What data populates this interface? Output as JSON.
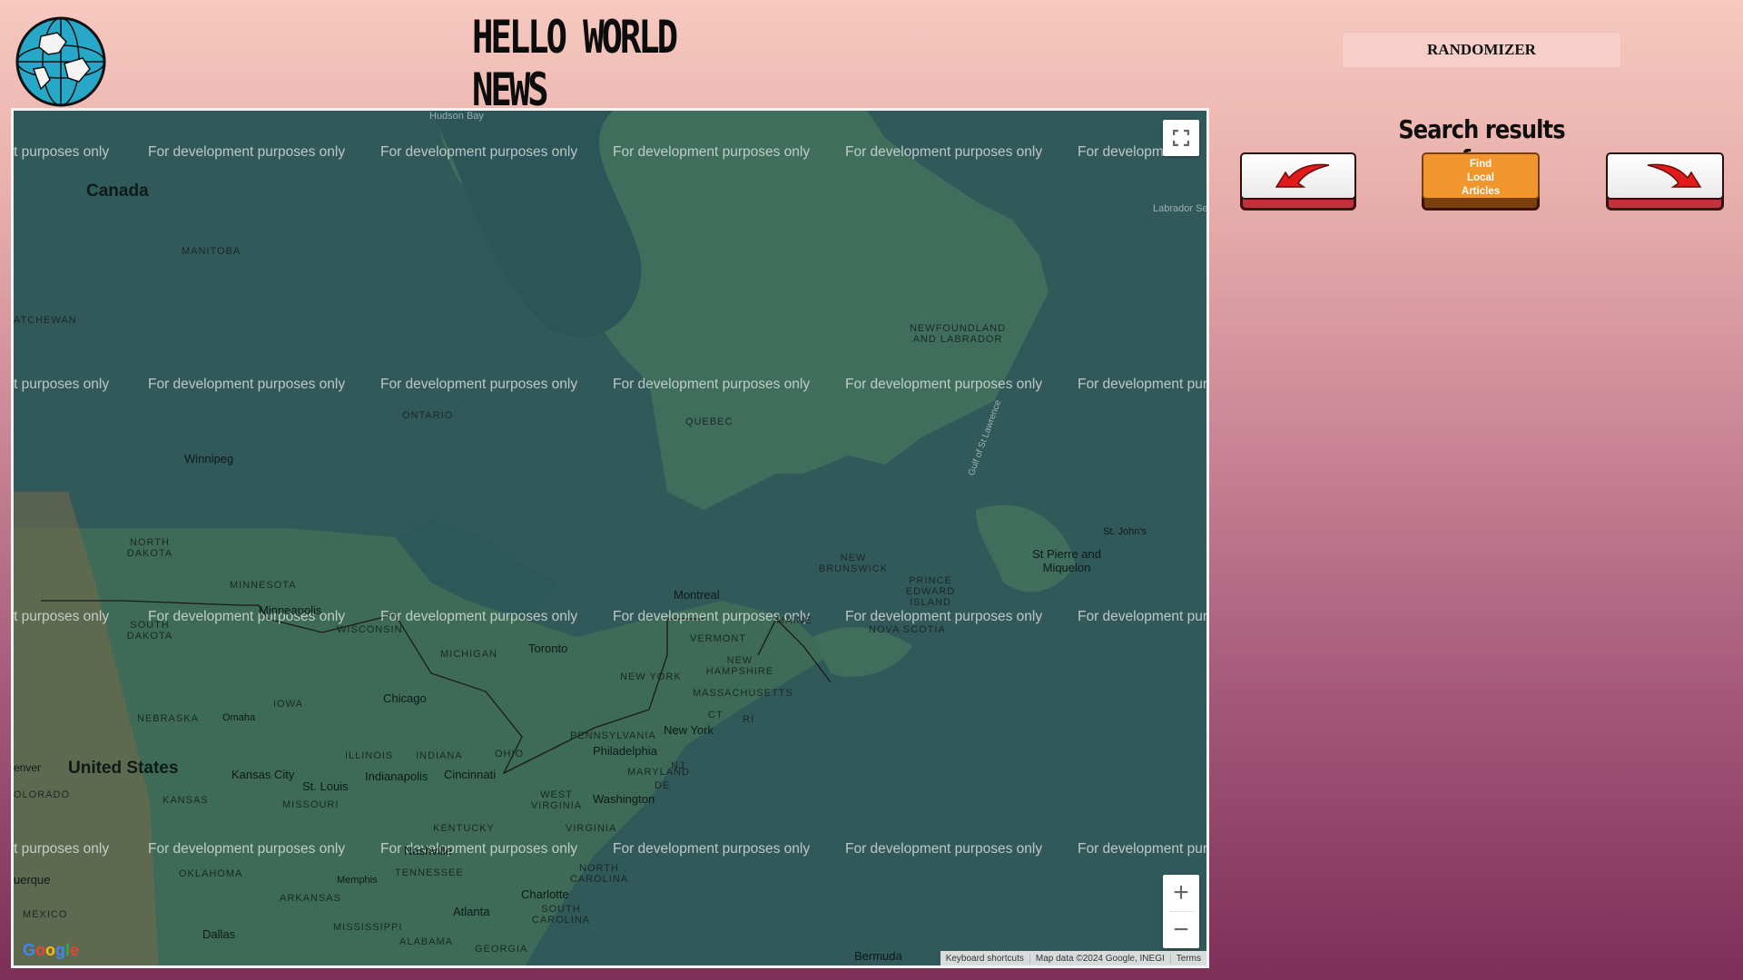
{
  "header": {
    "site_title": "HELLO WORLD NEWS",
    "logo_icon": "globe-icon",
    "randomizer_label": "RANDOMIZER"
  },
  "sidebar": {
    "search_title": "Search results for:",
    "prev_icon": "arrow-left-icon",
    "next_icon": "arrow-right-icon",
    "find_label_line1": "Find",
    "find_label_line2": "Local",
    "find_label_line3": "Articles"
  },
  "map": {
    "watermark": "For development purposes only",
    "watermark_cut_left": "t purposes only",
    "watermark_cut_right": "For developm",
    "watermark_cut_right2": "For development purp",
    "labels": {
      "hudson_bay": "Hudson Bay",
      "canada": "Canada",
      "labrador_sea": "Labrador Sea",
      "manitoba": "MANITOBA",
      "saskatchewan": "ATCHEWAN",
      "newfoundland": "NEWFOUNDLAND AND LABRADOR",
      "ontario": "ONTARIO",
      "quebec": "QUEBEC",
      "winnipeg": "Winnipeg",
      "gulf": "Gulf of St Lawrence",
      "st_johns": "St. John's",
      "st_pierre": "St Pierre and Miquelon",
      "north_dakota": "NORTH DAKOTA",
      "new_brunswick": "NEW BRUNSWICK",
      "pei": "PRINCE EDWARD ISLAND",
      "minnesota": "MINNESOTA",
      "montreal": "Montreal",
      "minneapolis": "Minneapolis",
      "south_dakota": "SOUTH DAKOTA",
      "wisconsin": "WISCONSIN",
      "nova_scotia": "NOVA SCOTIA",
      "vermont": "VERMONT",
      "maine": "MAINE",
      "michigan": "MICHIGAN",
      "toronto": "Toronto",
      "new_hampshire": "NEW HAMPSHIRE",
      "new_york_state": "NEW YORK",
      "massachusetts": "MASSACHUSETTS",
      "iowa": "IOWA",
      "chicago": "Chicago",
      "nebraska": "NEBRASKA",
      "omaha": "Omaha",
      "ct": "CT",
      "ri": "RI",
      "new_york": "New York",
      "pennsylvania": "PENNSYLVANIA",
      "philadelphia": "Philadelphia",
      "denver": "enver",
      "united_states": "United States",
      "kansas_city": "Kansas City",
      "indianapolis": "Indianapolis",
      "cincinnati": "Cincinnati",
      "illinois": "ILLINOIS",
      "indiana": "INDIANA",
      "ohio": "OHIO",
      "maryland": "MARYLAND",
      "nj": "NJ",
      "colorado": "OLORADO",
      "st_louis": "St. Louis",
      "washington": "Washington",
      "de": "DE",
      "kansas": "KANSAS",
      "missouri": "MISSOURI",
      "west_virginia": "WEST VIRGINIA",
      "kentucky": "KENTUCKY",
      "virginia": "VIRGINIA",
      "nashville": "Nashville",
      "tennessee": "TENNESSEE",
      "oklahoma": "OKLAHOMA",
      "north_carolina": "NORTH CAROLINA",
      "albuquerque": "uerque",
      "memphis": "Memphis",
      "charlotte": "Charlotte",
      "arkansas": "ARKANSAS",
      "new_mexico": "MEXICO",
      "atlanta": "Atlanta",
      "south_carolina": "SOUTH CAROLINA",
      "mississippi": "MISSISSIPPI",
      "dallas": "Dallas",
      "alabama": "ALABAMA",
      "georgia": "GEORGIA",
      "bermuda": "Bermuda"
    },
    "fullscreen_icon": "fullscreen-icon",
    "zoom_in": "+",
    "zoom_out": "−",
    "google_logo": "Google",
    "attribution": {
      "shortcuts": "Keyboard shortcuts",
      "data": "Map data ©2024 Google, INEGI",
      "terms": "Terms"
    }
  }
}
